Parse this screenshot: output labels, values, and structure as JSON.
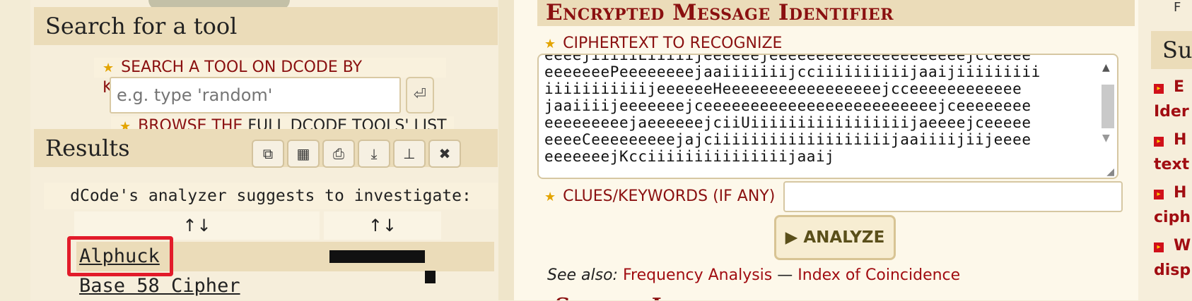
{
  "left": {
    "search_heading": "Search for a tool",
    "search_label": "SEARCH A TOOL ON DCODE BY KEYWORDS:",
    "search_placeholder": "e.g. type 'random'",
    "search_go_symbol": "⏎",
    "browse_prefix": "BROWSE THE ",
    "browse_link": "FULL DCODE TOOLS' LIST",
    "results_heading": "Results",
    "toolbar_icons": [
      "copy-icon",
      "save-icon",
      "print-icon",
      "download-icon",
      "pin-icon",
      "close-icon"
    ],
    "suggest_text": "dCode's analyzer suggests to investigate:",
    "sort_symbol": "↑↓",
    "results": [
      {
        "name": "Alphuck",
        "score": 0.9
      },
      {
        "name": "Base 58 Cipher",
        "score": 0.1
      }
    ]
  },
  "middle": {
    "title": "Encrypted Message Identifier",
    "ciphertext_label": "CIPHERTEXT TO RECOGNIZE",
    "ciphertext_lines": [
      "eeeejiiiiiLiiiiijeeeeeejeeeeeeeeeeeeeeeeeeeeejcceeee",
      "eeeeeeePeeeeeeeejaaiiiiiiijcciiiiiiiiiijaaijiiiiiiiii",
      "iiiiiiiiiiijeeeeeeHeeeeeeeeeeeeeeeeejcceeeeeeeeeeee",
      "jaaiiiijeeeeeeejceeeeeeeeeeeeeeeeeeeeeeeeejceeeeeeee",
      "eeeeeeeeejaeeeeeejciiUiiiiiiiiiiiiiiiiijaeeeejceeeee",
      "eeeeCeeeeeeeeejajciiiiiiiiiiiiiiiiiiijaaiiiijiijeeee",
      "eeeeeeejKcciiiiiiiiiiiiiiijaaij"
    ],
    "clues_label": "CLUES/KEYWORDS (IF ANY)",
    "clues_value": "",
    "analyze_label": "▶ ANALYZE",
    "see_also_prefix": "See also:",
    "see_also_links": [
      "Frequency Analysis",
      "Index of Coincidence"
    ],
    "see_also_separator": " — ",
    "next_section_title": "Symbols Identifier"
  },
  "right": {
    "heading_partial": "Su",
    "top_partial": "F",
    "items": [
      "E",
      "Ider",
      "H",
      "text",
      "H",
      "ciph",
      "W",
      "disp"
    ]
  },
  "colors": {
    "heading_red": "#8a1010",
    "link_red": "#a10d12",
    "highlight_red": "#e21b2a",
    "star_gold": "#e3a400",
    "panel_tan": "#ebdcb9"
  }
}
